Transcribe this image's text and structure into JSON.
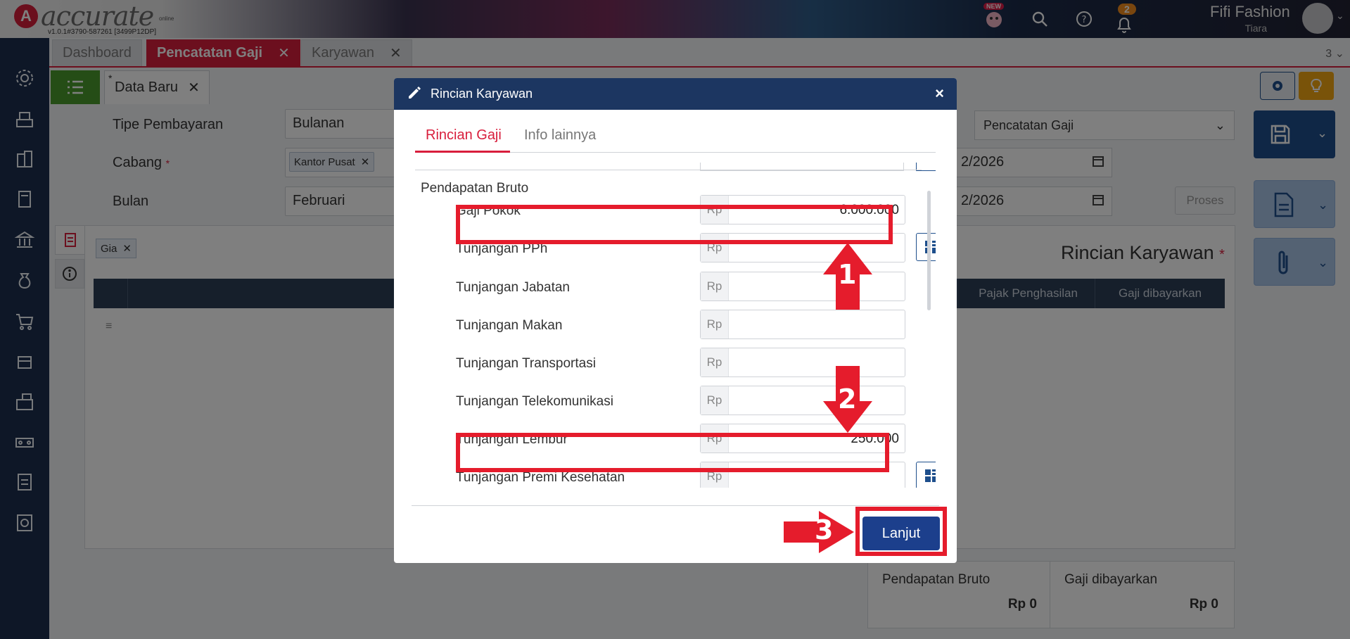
{
  "topbar": {
    "logo_text": "accurate",
    "logo_sub": "online",
    "version": "v1.0.1#3790-587261 [3499P12DP]",
    "new_badge": "NEW",
    "notif_count": "2",
    "company": "Fifi Fashion",
    "user": "Tiara"
  },
  "tabs": {
    "items": [
      {
        "label": "Dashboard"
      },
      {
        "label": "Pencatatan Gaji"
      },
      {
        "label": "Karyawan"
      }
    ],
    "more": "3"
  },
  "subtab": {
    "label": "Data Baru",
    "star": "*"
  },
  "form": {
    "tipe_label": "Tipe Pembayaran",
    "tipe_value": "Bulanan",
    "cabang_label": "Cabang",
    "cabang_chip": "Kantor Pusat",
    "bulan_label": "Bulan",
    "bulan_value": "Februari",
    "select_value": "Pencatatan Gaji",
    "date1": "2/2026",
    "date2": "2/2026",
    "proses_label": "Proses"
  },
  "panel": {
    "search_chip": "Gia",
    "title": "Rincian Karyawan",
    "columns": [
      "Pajak Penghasilan",
      "Gaji dibayarkan"
    ],
    "totals": [
      {
        "label": "Pendapatan Bruto",
        "value": "Rp 0"
      },
      {
        "label": "Gaji dibayarkan",
        "value": "Rp 0"
      }
    ]
  },
  "modal": {
    "title": "Rincian Karyawan",
    "close": "×",
    "tabs": [
      "Rincian Gaji",
      "Info lainnya"
    ],
    "section": "Pendapatan Bruto",
    "currency": "Rp",
    "rows": [
      {
        "label": "Gaji Pokok",
        "value": "6.000.000"
      },
      {
        "label": "Tunjangan PPh",
        "value": ""
      },
      {
        "label": "Tunjangan Jabatan",
        "value": ""
      },
      {
        "label": "Tunjangan Makan",
        "value": ""
      },
      {
        "label": "Tunjangan Transportasi",
        "value": ""
      },
      {
        "label": "Tunjangan Telekomunikasi",
        "value": ""
      },
      {
        "label": "Tunjangan Lembur",
        "value": "250.000"
      },
      {
        "label": "Tunjangan Premi Kesehatan",
        "value": ""
      }
    ],
    "next_label": "Lanjut"
  },
  "annotations": {
    "step1": "1",
    "step2": "2",
    "step3": "3",
    "color": "#e51c2c"
  }
}
